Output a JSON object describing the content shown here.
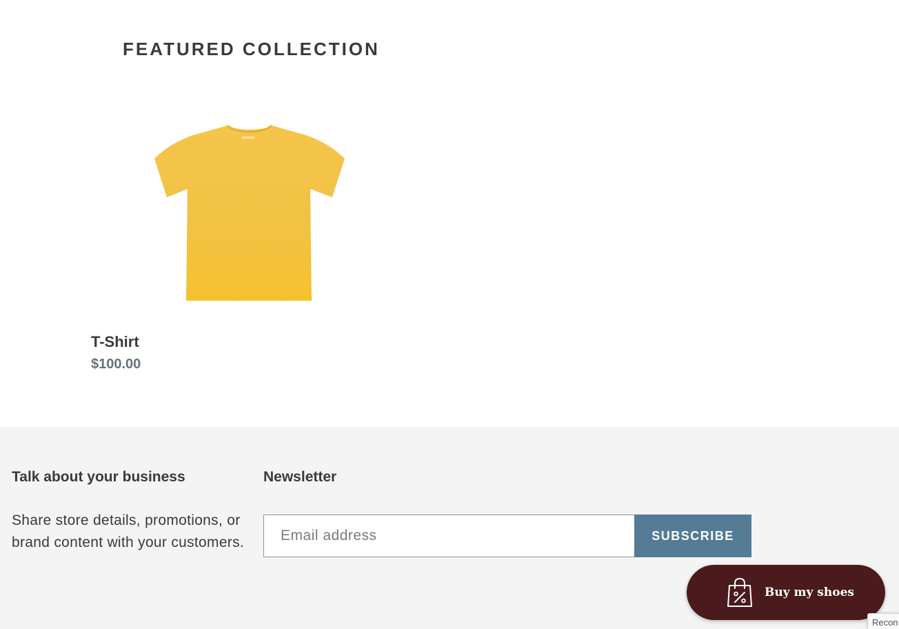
{
  "featured": {
    "title": "FEATURED COLLECTION",
    "products": [
      {
        "title": "T-Shirt",
        "price": "$100.00",
        "image_icon": "yellow-tshirt-image",
        "color": "#f3c33e"
      }
    ]
  },
  "footer": {
    "about": {
      "heading": "Talk about your business",
      "text": "Share store details, promotions, or brand content with your customers."
    },
    "newsletter": {
      "heading": "Newsletter",
      "email_placeholder": "Email address",
      "email_value": "",
      "subscribe_label": "SUBSCRIBE",
      "button_color": "#557b97"
    }
  },
  "floating_button": {
    "label": "Buy my shoes",
    "icon": "shopping-bag-percent-icon",
    "color": "#4a1a1c"
  },
  "recaptcha": {
    "label": "Recon"
  }
}
